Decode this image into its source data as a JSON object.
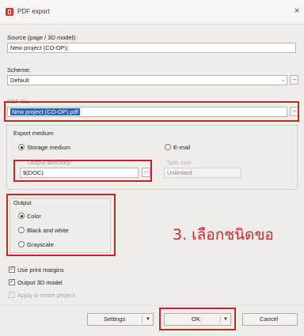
{
  "window": {
    "title": "PDF export"
  },
  "source": {
    "label": "Source (page / 3D model):",
    "value": "New project (CO-OP);"
  },
  "scheme": {
    "label": "Scheme:",
    "value": "Default"
  },
  "pdf_file": {
    "label": "PDF file:",
    "value": "New project (CO-OP).pdf"
  },
  "export_medium": {
    "label": "Export medium",
    "storage_label": "Storage medium",
    "email_label": "E-mail",
    "output_dir_label": "Output directory:",
    "output_dir_value": "$(DOC)",
    "split_size_label": "Split size:",
    "split_size_value": "Unlimited"
  },
  "output": {
    "label": "Output",
    "options": [
      "Color",
      "Black and white",
      "Grayscale"
    ],
    "selected": "Color"
  },
  "options": {
    "use_print_margins": "Use print margins",
    "output_3d_model": "Output 3D model",
    "apply_to_entire_project": "Apply to entire project"
  },
  "buttons": {
    "settings": "Settings",
    "ok": "OK",
    "cancel": "Cancel",
    "browse": "..."
  },
  "annotation": {
    "text": "3. เลือกชนิดขอ"
  },
  "colors": {
    "highlight": "#c8232c",
    "selection": "#2c62b7"
  }
}
